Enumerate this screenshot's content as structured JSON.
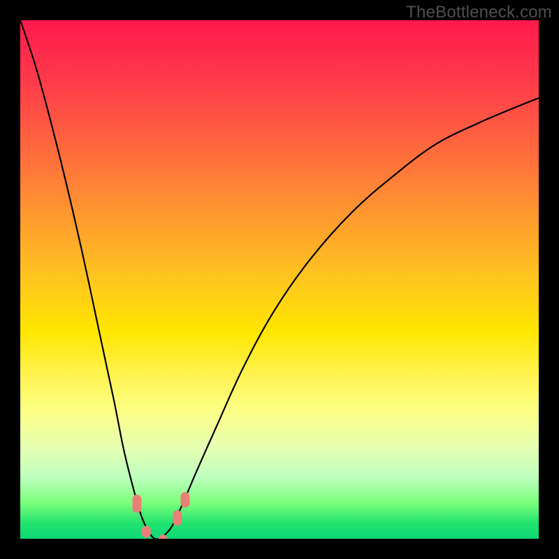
{
  "watermark": "TheBottleneck.com",
  "chart_data": {
    "type": "line",
    "title": "",
    "xlabel": "",
    "ylabel": "",
    "xlim": [
      0,
      100
    ],
    "ylim": [
      0,
      100
    ],
    "series": [
      {
        "name": "curve-left",
        "x": [
          0,
          3,
          6,
          9,
          12,
          15,
          18,
          20,
          22,
          23.5,
          25,
          26,
          27
        ],
        "y": [
          100,
          91,
          80,
          68,
          55,
          41,
          27,
          17,
          9,
          4,
          1,
          0,
          0
        ]
      },
      {
        "name": "curve-right",
        "x": [
          27,
          29,
          31,
          34,
          38,
          43,
          49,
          56,
          64,
          72,
          80,
          88,
          95,
          100
        ],
        "y": [
          0,
          2,
          6,
          13,
          22,
          33,
          44,
          54,
          63,
          70,
          76,
          80,
          83,
          85
        ]
      }
    ],
    "markers": [
      {
        "name": "marker-left-a",
        "x": 22.5,
        "y_top": 8.5,
        "y_bot": 5.0
      },
      {
        "name": "marker-left-b",
        "x": 24.3,
        "y_top": 2.5,
        "y_bot": 0.2
      },
      {
        "name": "marker-bottom-a",
        "x": 27.5,
        "y_top": 0.8,
        "y_bot": 0.0
      },
      {
        "name": "marker-right-a",
        "x": 30.3,
        "y_top": 5.5,
        "y_bot": 2.5
      },
      {
        "name": "marker-right-b",
        "x": 31.8,
        "y_top": 9.0,
        "y_bot": 6.0
      }
    ],
    "colors": {
      "curve": "#000000",
      "marker_fill": "#e98077"
    }
  }
}
